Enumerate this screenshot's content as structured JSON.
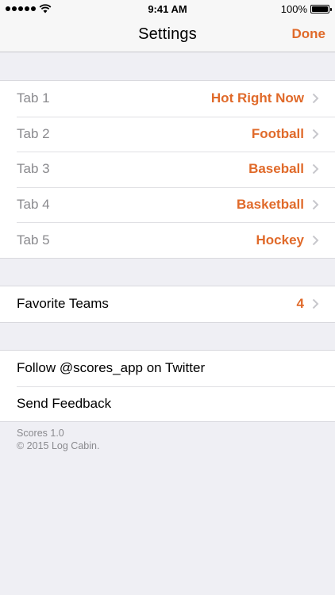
{
  "status_bar": {
    "time": "9:41 AM",
    "battery": "100%",
    "signal_icon": "signal-dots-icon",
    "wifi_icon": "wifi-icon",
    "battery_icon": "battery-icon"
  },
  "nav": {
    "title": "Settings",
    "done_label": "Done"
  },
  "colors": {
    "accent": "#e06a2a",
    "background": "#efeff4",
    "muted_text": "#8a8a8e"
  },
  "tabs": [
    {
      "label": "Tab 1",
      "value": "Hot Right Now"
    },
    {
      "label": "Tab 2",
      "value": "Football"
    },
    {
      "label": "Tab 3",
      "value": "Baseball"
    },
    {
      "label": "Tab 4",
      "value": "Basketball"
    },
    {
      "label": "Tab 5",
      "value": "Hockey"
    }
  ],
  "favorites": {
    "label": "Favorite Teams",
    "value": "4"
  },
  "links": [
    {
      "label": "Follow @scores_app on Twitter"
    },
    {
      "label": "Send Feedback"
    }
  ],
  "footer": {
    "version": "Scores 1.0",
    "copyright": "© 2015 Log Cabin."
  }
}
